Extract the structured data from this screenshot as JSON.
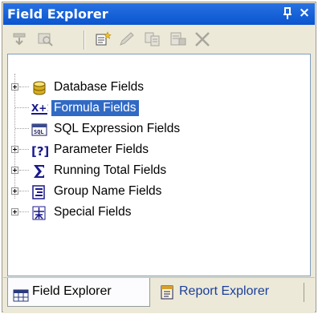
{
  "window": {
    "title": "Field Explorer",
    "pin_label": "ᵻ",
    "close_label": "×"
  },
  "toolbar": {
    "buttons": [
      {
        "name": "insert-to-report-icon",
        "enabled": false
      },
      {
        "name": "browse-data-icon",
        "enabled": false
      },
      {
        "name": "new-icon",
        "enabled": true
      },
      {
        "name": "edit-icon",
        "enabled": false
      },
      {
        "name": "duplicate-icon",
        "enabled": false
      },
      {
        "name": "rename-icon",
        "enabled": false
      },
      {
        "name": "delete-icon",
        "enabled": false
      }
    ]
  },
  "tree": {
    "items": [
      {
        "label": "Database Fields",
        "icon": "database-icon",
        "expandable": true,
        "selected": false
      },
      {
        "label": "Formula Fields",
        "icon": "formula-icon",
        "expandable": false,
        "selected": true
      },
      {
        "label": "SQL Expression Fields",
        "icon": "sql-icon",
        "expandable": false,
        "selected": false
      },
      {
        "label": "Parameter Fields",
        "icon": "parameter-icon",
        "expandable": true,
        "selected": false
      },
      {
        "label": "Running Total Fields",
        "icon": "sigma-icon",
        "expandable": true,
        "selected": false
      },
      {
        "label": "Group Name Fields",
        "icon": "group-icon",
        "expandable": true,
        "selected": false
      },
      {
        "label": "Special Fields",
        "icon": "special-icon",
        "expandable": true,
        "selected": false
      }
    ]
  },
  "tabs": [
    {
      "label": "Field Explorer",
      "icon": "field-explorer-icon",
      "active": true
    },
    {
      "label": "Report Explorer",
      "icon": "report-explorer-icon",
      "active": false
    }
  ],
  "colors": {
    "title_bar": "#0a54cf",
    "selection": "#316ac5",
    "panel_bg": "#ece9d8"
  }
}
